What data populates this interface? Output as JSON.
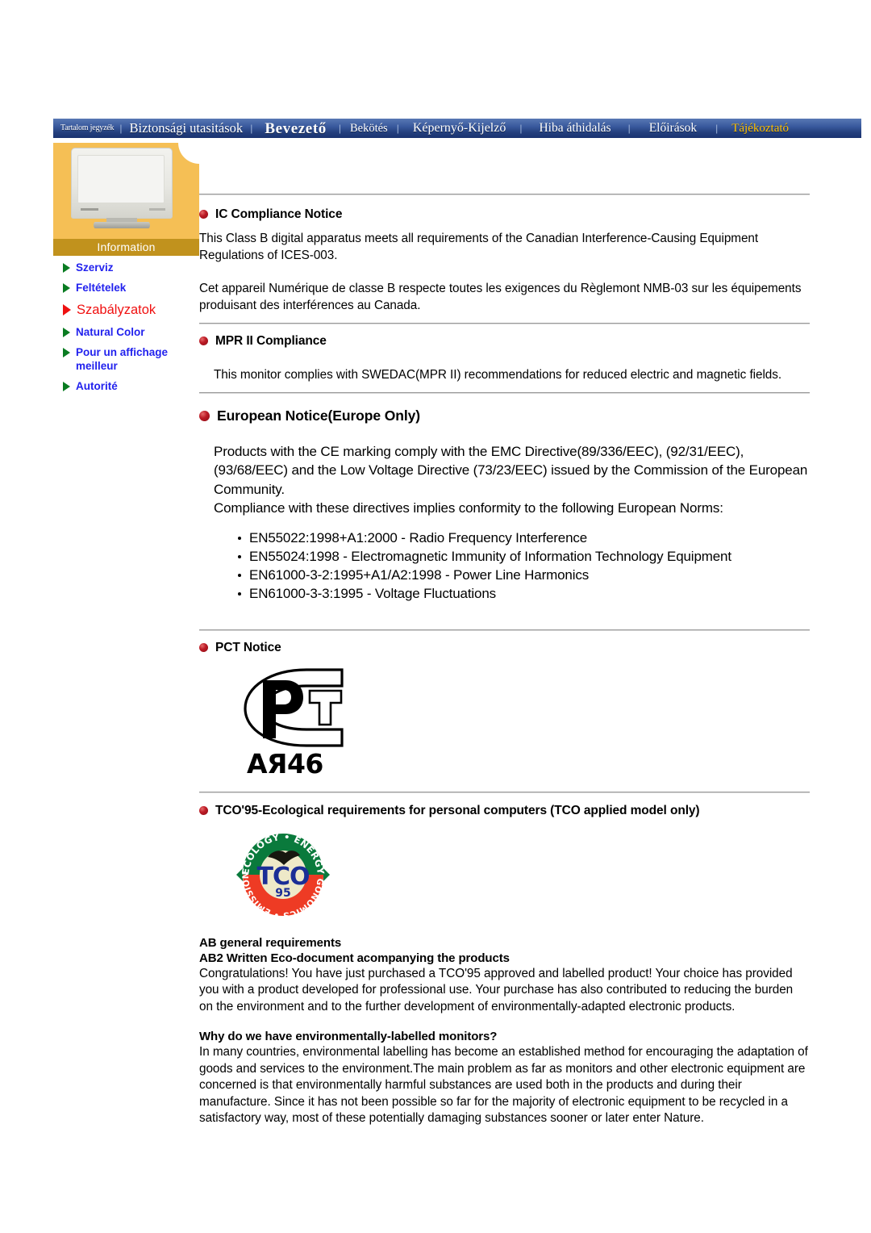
{
  "nav": {
    "items": [
      {
        "label": "Tartalom jegyzék",
        "active": false
      },
      {
        "label": "Biztonsági utasitások",
        "active": false
      },
      {
        "label": "Bevezető",
        "active": false
      },
      {
        "label": "Bekötés",
        "active": false
      },
      {
        "label": "Képernyő-Kijelző",
        "active": false
      },
      {
        "label": "Hiba áthidalás",
        "active": false
      },
      {
        "label": "Előirások",
        "active": false
      },
      {
        "label": "Tájékoztató",
        "active": true
      }
    ],
    "separator": "|",
    "active_color": "#ffc000",
    "bar_color": "#24407e"
  },
  "sidebar": {
    "panel_color": "#f5bf55",
    "banner_color": "#c1921d",
    "banner_label": "Information",
    "monitor_icon": "crt-monitor-icon",
    "items": [
      {
        "label": "Szerviz",
        "active": false
      },
      {
        "label": "Feltételek",
        "active": false
      },
      {
        "label": "Szabályzatok",
        "active": true
      },
      {
        "label": "Natural Color",
        "active": false
      },
      {
        "label": "Pour un affichage meilleur",
        "active": false
      },
      {
        "label": "Autorité",
        "active": false
      }
    ],
    "link_color": "#2222ee",
    "active_link_color": "#f01010"
  },
  "main": {
    "bullet_color": "#bb1a25",
    "ic": {
      "heading": "IC Compliance Notice",
      "para_en": "This Class B digital apparatus meets all requirements of the Canadian Interference-Causing Equipment Regulations of ICES-003.",
      "para_fr": "Cet appareil Numérique de classe B respecte toutes les exigences du Règlemont NMB-03 sur les équipements produisant des interférences au Canada."
    },
    "mpr": {
      "heading": "MPR II Compliance",
      "para": "This monitor complies with SWEDAC(MPR II) recommendations for reduced electric and magnetic fields."
    },
    "european": {
      "heading": "European Notice(Europe Only)",
      "para1": "Products with the CE marking comply with the EMC Directive(89/336/EEC), (92/31/EEC), (93/68/EEC) and the Low Voltage Directive (73/23/EEC) issued by the Commission of the European Community.",
      "para2": "Compliance with these directives implies conformity to the following European Norms:",
      "norms": [
        "EN55022:1998+A1:2000 - Radio Frequency Interference",
        "EN55024:1998 - Electromagnetic Immunity of Information Technology Equipment",
        "EN61000-3-2:1995+A1/A2:1998 - Power Line Harmonics",
        "EN61000-3-3:1995 - Voltage Fluctuations"
      ]
    },
    "pct": {
      "heading": "PCT Notice",
      "logo_name": "pct-certification-mark",
      "logo_code": "АЯ46"
    },
    "tco": {
      "heading": "TCO'95-Ecological requirements for personal computers (TCO applied model only)",
      "logo_name": "tco-95-eco-label",
      "logo_top_text": "ECOLOGY • ENERGY",
      "logo_bottom_text": "ERGONOMICS • EMISSIONS",
      "logo_center_text": "TCO",
      "logo_year": "95",
      "logo_green": "#0a7a3c",
      "logo_red": "#ee3b24",
      "logo_blue": "#1b2e96",
      "sub1": "AB general requirements",
      "sub2": "AB2 Written Eco-document acompanying the products",
      "para1": "Congratulations! You have just purchased a TCO'95 approved and labelled product! Your choice has provided you with a product developed for professional use. Your purchase has also contributed to reducing the burden on the environment and to the further development of environmentally-adapted electronic products.",
      "sub3": "Why do we have environmentally-labelled monitors?",
      "para2": "In many countries, environmental labelling has become an established method for encouraging the adaptation of goods and services to the environment.The main problem as far as monitors and other electronic equipment are concerned is that environmentally harmful substances are used both in the products and during their manufacture. Since it has not been possible so far for the majority of electronic equipment to be recycled in a satisfactory way, most of these potentially damaging substances sooner or later enter Nature."
    }
  }
}
